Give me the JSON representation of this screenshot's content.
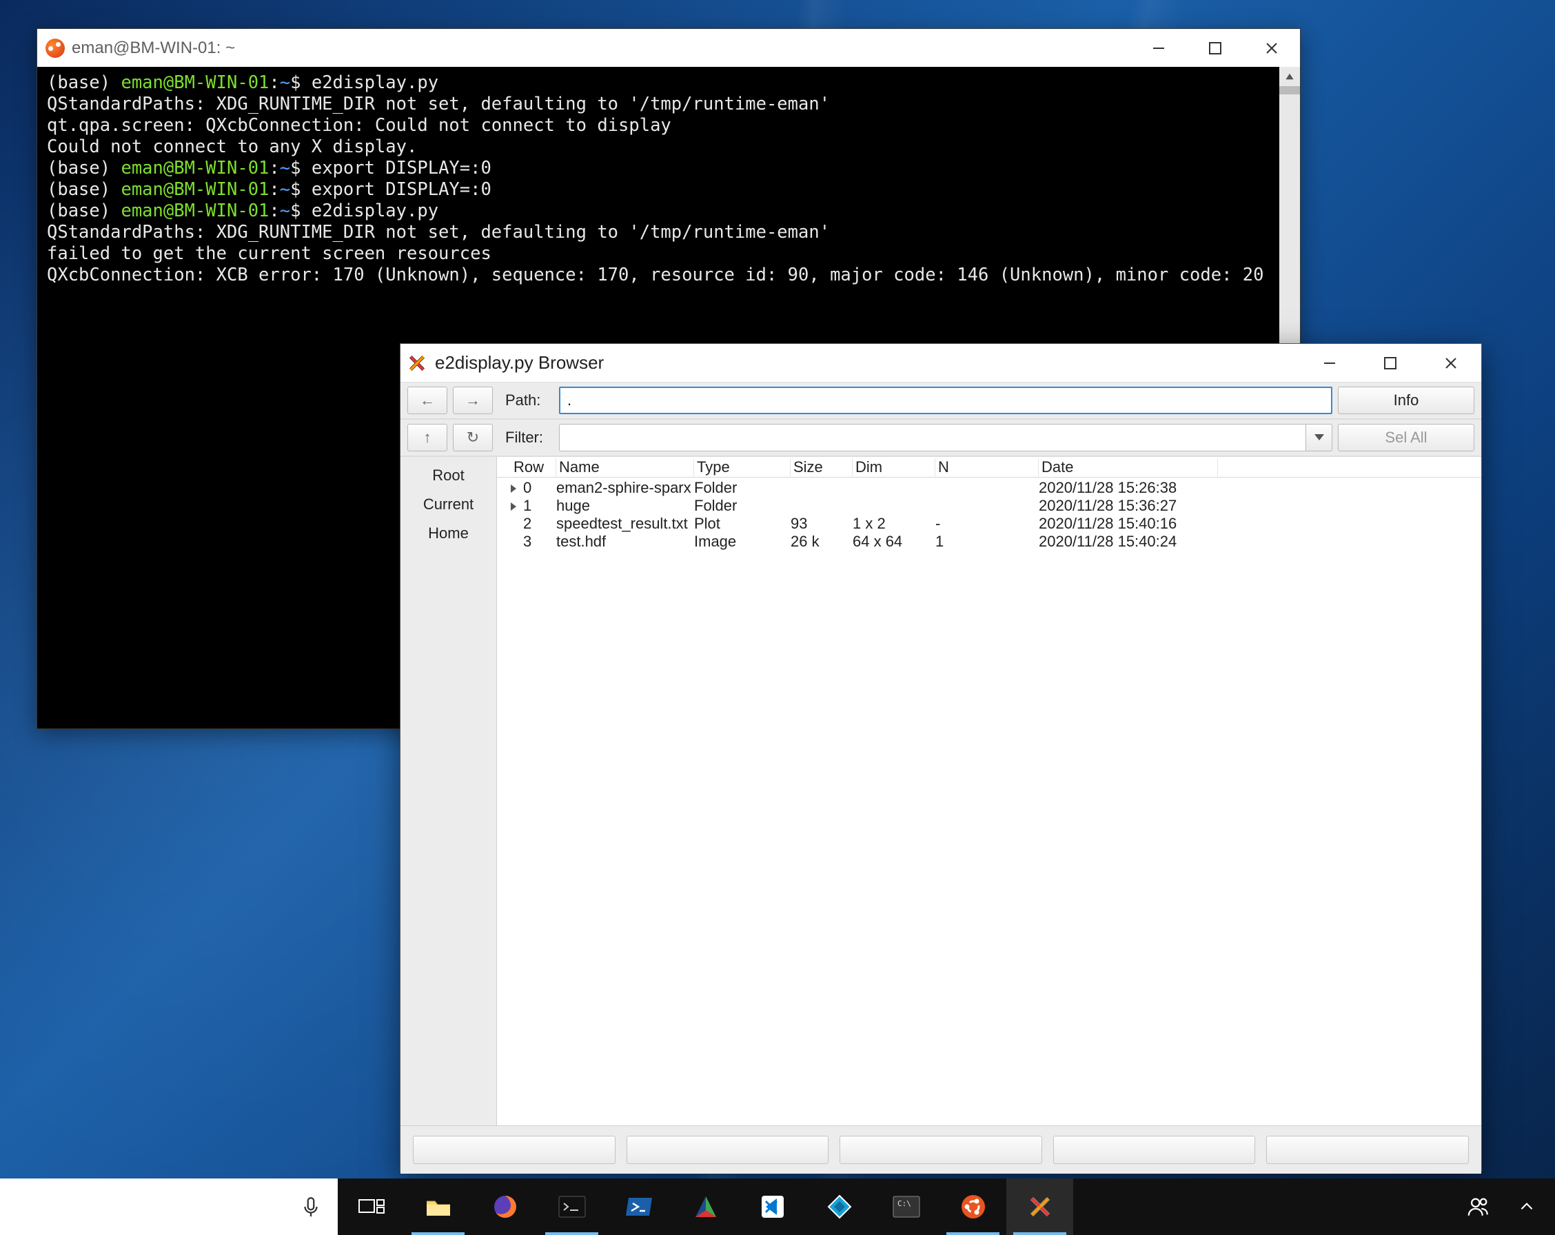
{
  "terminal": {
    "title": "eman@BM-WIN-01: ~",
    "lines": [
      {
        "prompt_env": "(base) ",
        "prompt_user": "eman@BM-WIN-01",
        "prompt_sep": ":",
        "prompt_path": "~",
        "prompt_end": "$ ",
        "cmd": "e2display.py"
      },
      {
        "text": "QStandardPaths: XDG_RUNTIME_DIR not set, defaulting to '/tmp/runtime-eman'"
      },
      {
        "text": "qt.qpa.screen: QXcbConnection: Could not connect to display"
      },
      {
        "text": "Could not connect to any X display."
      },
      {
        "prompt_env": "(base) ",
        "prompt_user": "eman@BM-WIN-01",
        "prompt_sep": ":",
        "prompt_path": "~",
        "prompt_end": "$ ",
        "cmd": "export DISPLAY=:0"
      },
      {
        "prompt_env": "(base) ",
        "prompt_user": "eman@BM-WIN-01",
        "prompt_sep": ":",
        "prompt_path": "~",
        "prompt_end": "$ ",
        "cmd": "export DISPLAY=:0"
      },
      {
        "prompt_env": "(base) ",
        "prompt_user": "eman@BM-WIN-01",
        "prompt_sep": ":",
        "prompt_path": "~",
        "prompt_end": "$ ",
        "cmd": "e2display.py"
      },
      {
        "text": "QStandardPaths: XDG_RUNTIME_DIR not set, defaulting to '/tmp/runtime-eman'"
      },
      {
        "text": "failed to get the current screen resources"
      },
      {
        "text": "QXcbConnection: XCB error: 170 (Unknown), sequence: 170, resource id: 90, major code: 146 (Unknown), minor code: 20"
      }
    ]
  },
  "browser": {
    "title": "e2display.py Browser",
    "nav_back": "←",
    "nav_fwd": "→",
    "path_label": "Path:",
    "path_value": ".",
    "info_label": "Info",
    "up_label": "↑",
    "refresh_label": "↻",
    "filter_label": "Filter:",
    "filter_value": "",
    "selall_label": "Sel All",
    "sidebar": {
      "root": "Root",
      "current": "Current",
      "home": "Home"
    },
    "columns": {
      "row": "Row",
      "name": "Name",
      "type": "Type",
      "size": "Size",
      "dim": "Dim",
      "n": "N",
      "date": "Date"
    },
    "rows": [
      {
        "expandable": true,
        "row": "0",
        "name": "eman2-sphire-sparx",
        "type": "Folder",
        "size": "",
        "dim": "",
        "n": "",
        "date": "2020/11/28 15:26:38"
      },
      {
        "expandable": true,
        "row": "1",
        "name": "huge",
        "type": "Folder",
        "size": "",
        "dim": "",
        "n": "",
        "date": "2020/11/28 15:36:27"
      },
      {
        "expandable": false,
        "row": "2",
        "name": "speedtest_result.txt",
        "type": "Plot",
        "size": "93",
        "dim": "1 x 2",
        "n": "-",
        "date": "2020/11/28 15:40:16"
      },
      {
        "expandable": false,
        "row": "3",
        "name": "test.hdf",
        "type": "Image",
        "size": "26 k",
        "dim": "64 x 64",
        "n": "1",
        "date": "2020/11/28 15:40:24"
      }
    ]
  },
  "taskbar": {
    "apps": [
      "taskview",
      "explorer",
      "firefox",
      "terminal",
      "powershell",
      "cmake",
      "vscode",
      "sourcetree",
      "cmd",
      "ubuntu",
      "xming"
    ]
  }
}
